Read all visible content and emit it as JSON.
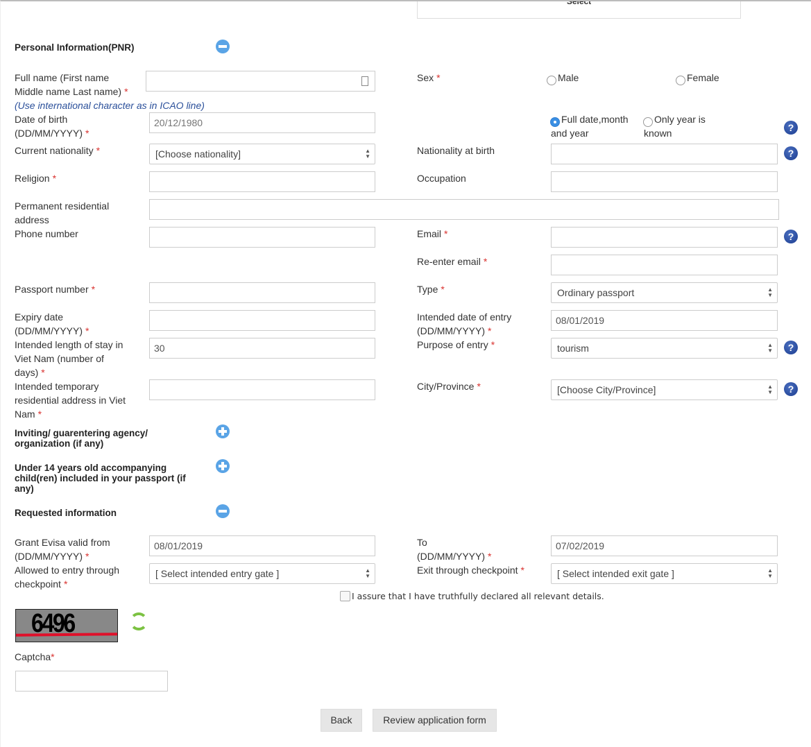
{
  "top_select": {
    "label": "Select"
  },
  "personal": {
    "title": "Personal Information(PNR)",
    "full_name": {
      "label": "Full name (First name Middle name Last name)",
      "hint": "(Use international character as in ICAO line)",
      "value": ""
    },
    "sex": {
      "label": "Sex",
      "options": [
        "Male",
        "Female"
      ]
    },
    "dob": {
      "label": "Date of birth (DD/MM/YYYY)",
      "placeholder": "20/12/1980",
      "options": [
        "Full date,month and year",
        "Only year is known"
      ],
      "selected": "Full date,month and year"
    },
    "current_nationality": {
      "label": "Current nationality",
      "value": "[Choose nationality]"
    },
    "nationality_at_birth": {
      "label": "Nationality at birth",
      "value": ""
    },
    "religion": {
      "label": "Religion",
      "value": ""
    },
    "occupation": {
      "label": "Occupation",
      "value": ""
    },
    "address": {
      "label": "Permanent residential address",
      "value": ""
    },
    "phone": {
      "label": "Phone number",
      "value": ""
    },
    "email": {
      "label": "Email",
      "value": ""
    },
    "reemail": {
      "label": "Re-enter email",
      "value": ""
    },
    "passport": {
      "label": "Passport number",
      "value": ""
    },
    "type": {
      "label": "Type",
      "value": "Ordinary passport"
    },
    "expiry": {
      "label": "Expiry date (DD/MM/YYYY)",
      "value": ""
    },
    "entry_date": {
      "label": "Intended date of entry (DD/MM/YYYY)",
      "value": "08/01/2019"
    },
    "stay": {
      "label": "Intended length of stay in Viet Nam (number of days)",
      "value": "30"
    },
    "purpose": {
      "label": "Purpose of entry",
      "value": "tourism"
    },
    "temp_address": {
      "label": "Intended temporary residential address in Viet Nam",
      "value": ""
    },
    "city": {
      "label": "City/Province",
      "value": "[Choose City/Province]"
    }
  },
  "inviting": {
    "title": "Inviting/ guarentering agency/ organization (if any)"
  },
  "children": {
    "title": "Under 14 years old accompanying child(ren) included in your passport (if any)"
  },
  "requested": {
    "title": "Requested information",
    "valid_from": {
      "label": "Grant Evisa valid from (DD/MM/YYYY)",
      "value": "08/01/2019"
    },
    "to": {
      "label": "To (DD/MM/YYYY)",
      "value": "07/02/2019"
    },
    "entry_gate": {
      "label": "Allowed to entry through checkpoint",
      "value": "[ Select intended entry gate ]"
    },
    "exit_gate": {
      "label": "Exit through checkpoint",
      "value": "[ Select intended exit gate ]"
    }
  },
  "assure": {
    "label": "I assure that I have truthfully declared all relevant details.",
    "checked": false
  },
  "captcha": {
    "image_text": "6496",
    "label": "Captcha",
    "value": ""
  },
  "buttons": {
    "back": "Back",
    "review": "Review application form"
  },
  "required_mark": "*",
  "help_glyph": "?",
  "colors": {
    "required": "#d9322f",
    "hint": "#2a4f9a",
    "toggle": "#5aa4e6",
    "help": "#1b3c8f",
    "refresh": "#7cc242"
  }
}
